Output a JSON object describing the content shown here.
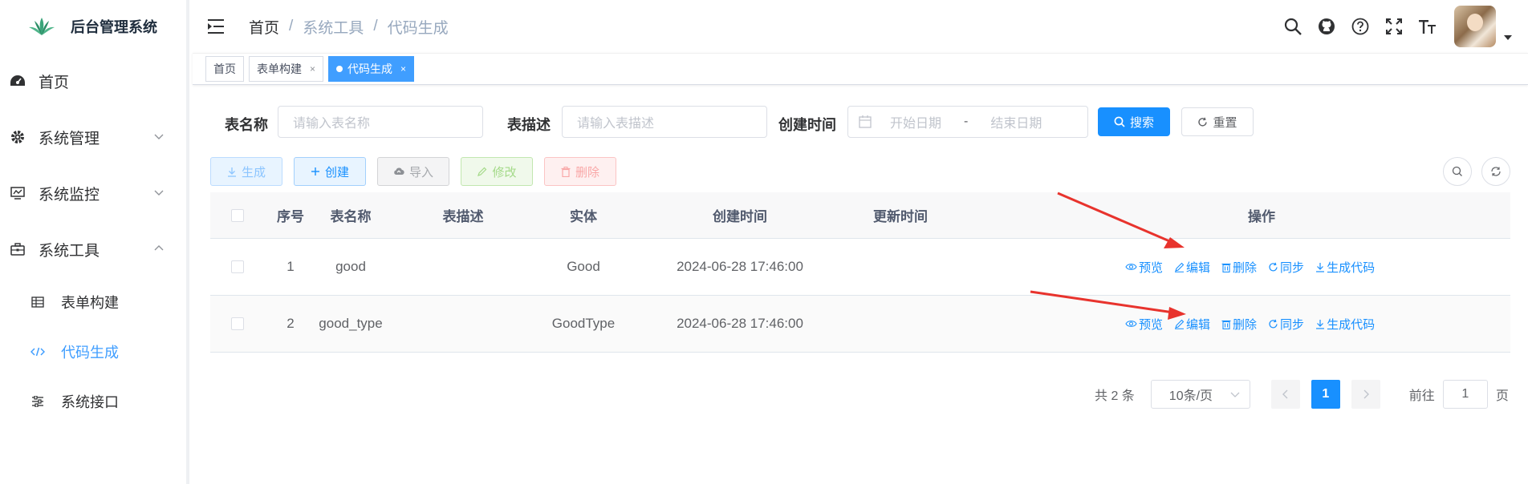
{
  "app": {
    "title": "后台管理系统"
  },
  "sidebar": {
    "items": [
      {
        "label": "首页",
        "icon": "dashboard-icon"
      },
      {
        "label": "系统管理",
        "icon": "gear-icon"
      },
      {
        "label": "系统监控",
        "icon": "monitor-icon"
      },
      {
        "label": "系统工具",
        "icon": "toolbox-icon",
        "expanded": true
      }
    ],
    "sub_items": [
      {
        "label": "表单构建",
        "icon": "table-grid-icon"
      },
      {
        "label": "代码生成",
        "icon": "code-icon",
        "active": true
      },
      {
        "label": "系统接口",
        "icon": "sliders-icon"
      }
    ]
  },
  "header": {
    "breadcrumb": [
      "首页",
      "系统工具",
      "代码生成"
    ],
    "separator": "/"
  },
  "tags": [
    {
      "label": "首页"
    },
    {
      "label": "表单构建",
      "close": "×"
    },
    {
      "label": "代码生成",
      "close": "×",
      "active": true
    }
  ],
  "search": {
    "table_name_label": "表名称",
    "table_name_placeholder": "请输入表名称",
    "table_desc_label": "表描述",
    "table_desc_placeholder": "请输入表描述",
    "create_time_label": "创建时间",
    "start_placeholder": "开始日期",
    "range_sep": "-",
    "end_placeholder": "结束日期",
    "search_button": "搜索",
    "reset_button": "重置"
  },
  "toolbar": {
    "generate": "生成",
    "create": "创建",
    "import": "导入",
    "edit": "修改",
    "delete": "删除"
  },
  "table": {
    "columns": [
      "序号",
      "表名称",
      "表描述",
      "实体",
      "创建时间",
      "更新时间",
      "操作"
    ],
    "rows": [
      {
        "index": "1",
        "table_name": "good",
        "table_desc": "",
        "entity": "Good",
        "created": "2024-06-28 17:46:00",
        "updated": ""
      },
      {
        "index": "2",
        "table_name": "good_type",
        "table_desc": "",
        "entity": "GoodType",
        "created": "2024-06-28 17:46:00",
        "updated": ""
      }
    ],
    "actions": [
      "预览",
      "编辑",
      "删除",
      "同步",
      "生成代码"
    ]
  },
  "pagination": {
    "total_text": "共 2 条",
    "page_size": "10条/页",
    "current_page": "1",
    "goto_prefix": "前往",
    "goto_value": "1",
    "goto_suffix": "页"
  },
  "colors": {
    "primary": "#1890ff",
    "active_menu": "#409eff",
    "annotation_arrow": "#e8332d"
  }
}
